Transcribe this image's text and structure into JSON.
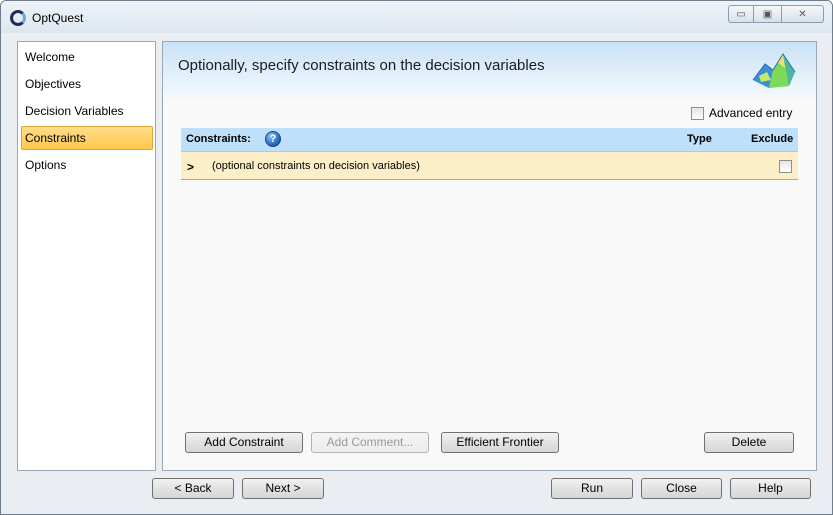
{
  "window": {
    "title": "OptQuest",
    "controls": {
      "minimize": "▭",
      "maximize": "▣",
      "close": "✕"
    }
  },
  "nav": {
    "items": [
      {
        "label": "Welcome",
        "active": false
      },
      {
        "label": "Objectives",
        "active": false
      },
      {
        "label": "Decision Variables",
        "active": false
      },
      {
        "label": "Constraints",
        "active": true
      },
      {
        "label": "Options",
        "active": false
      }
    ]
  },
  "main": {
    "heading": "Optionally, specify constraints on the decision variables",
    "advanced_entry": {
      "label": "Advanced entry",
      "checked": false
    },
    "table": {
      "columns": [
        "Constraints:",
        "Type",
        "Exclude"
      ],
      "help_icon": "?",
      "rows": [
        {
          "marker": ">",
          "text": "(optional constraints on decision variables)",
          "type": "",
          "exclude": false
        }
      ]
    },
    "buttons": {
      "add_constraint": "Add Constraint",
      "add_comment": "Add Comment...",
      "efficient_frontier": "Efficient Frontier",
      "delete": "Delete"
    }
  },
  "footer": {
    "back": "< Back",
    "next": "Next >",
    "run": "Run",
    "close": "Close",
    "help": "Help"
  },
  "colors": {
    "accent_header": "#bfe0fa",
    "row_highlight": "#fcefc7",
    "active_nav": "#ffc84a"
  }
}
